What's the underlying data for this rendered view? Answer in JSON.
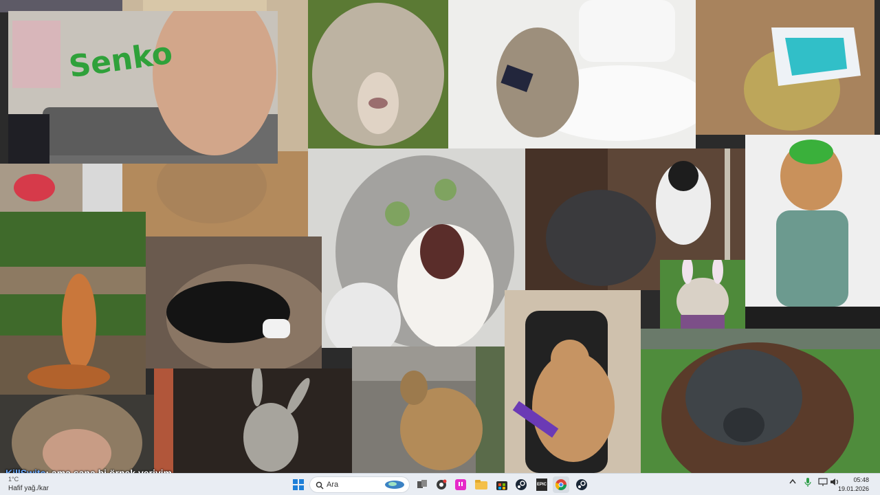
{
  "overlay_chat": {
    "username": "KillSwitc",
    "message": ": ama sana bi örnek veriyim"
  },
  "webcam": {
    "wall_text": "Senko"
  },
  "taskbar": {
    "weather_temp": "1°C",
    "weather_desc": "Hafif yağ./kar",
    "search_placeholder": "Ara",
    "epic_label": "EPIC",
    "time": "05:48",
    "date": "19.01.2026"
  },
  "collage": [
    "curly-sheep",
    "cat-on-toilet-with-phone",
    "frog-in-dirt",
    "webcam-room",
    "shocked-cat",
    "cat-kicking-dog",
    "cat-in-green-hat",
    "bulldog-bunny-ears",
    "squirrel-arms-up",
    "black-dog-with-controller",
    "dog-on-couch",
    "donkey",
    "dogs-on-street",
    "cat-gaming-headset",
    "orangutan",
    "monkey"
  ]
}
